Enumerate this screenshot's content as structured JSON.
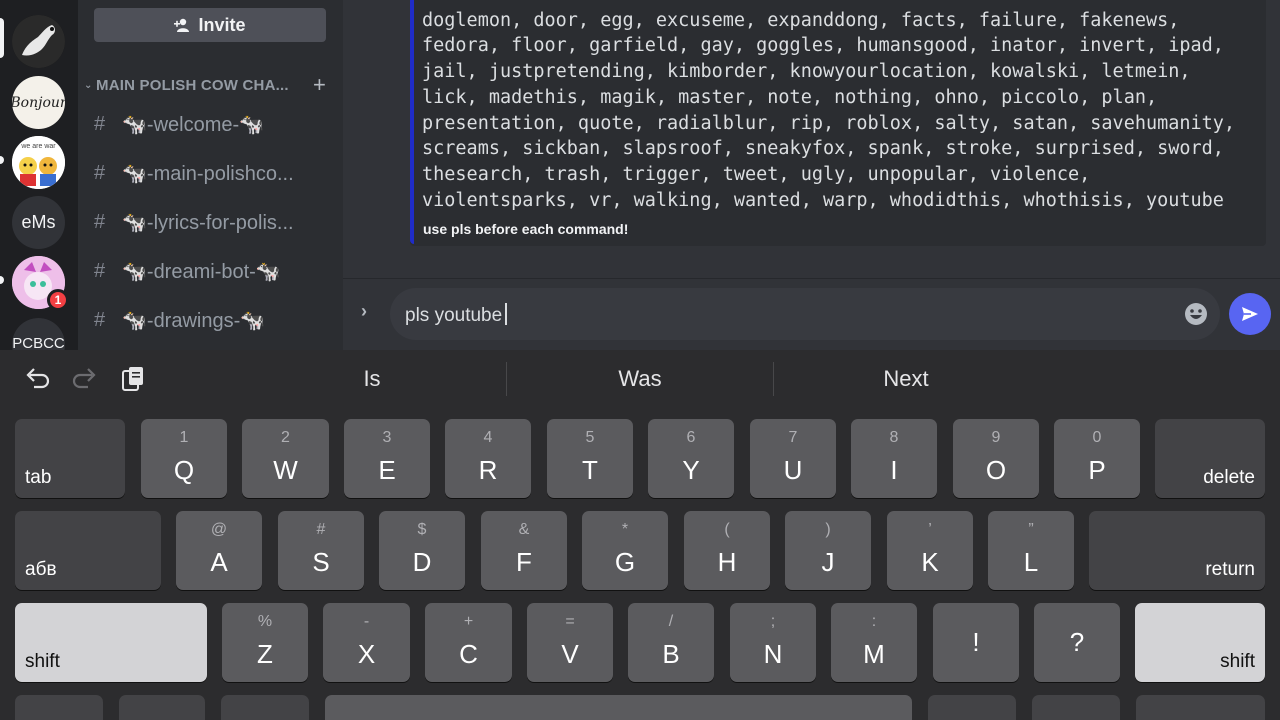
{
  "sidebar": {
    "invite_label": "Invite",
    "category": "MAIN POLISH COW CHA...",
    "channels": [
      {
        "label": "🐄-welcome-🐄"
      },
      {
        "label": "🐄-main-polishco..."
      },
      {
        "label": "🐄-lyrics-for-polis..."
      },
      {
        "label": "🐄-dreami-bot-🐄"
      },
      {
        "label": "🐄-drawings-🐄"
      }
    ]
  },
  "servers": {
    "bonjour_text": "Bonjour",
    "were_war_text": "we are war",
    "ems_label": "eMs",
    "badge_count": "1",
    "pcbcc_label": "PCBCC"
  },
  "embed": {
    "command_lines": [
      "                                           ",
      "doglemon, door, egg, excuseme, expanddong, facts, failure, fakenews,",
      "fedora, floor, garfield, gay, goggles, humansgood, inator, invert, ipad,",
      "jail, justpretending, kimborder, knowyourlocation, kowalski, letmein,",
      "lick, madethis, magik, master, note, nothing, ohno, piccolo, plan,",
      "presentation, quote, radialblur, rip, roblox, salty, satan, savehumanity,",
      "screams, sickban, slapsroof, sneakyfox, spank, stroke, surprised, sword,",
      "thesearch, trash, trigger, tweet, ugly, unpopular, violence,",
      "violentsparks, vr, walking, wanted, warp, whodidthis, whothisis, youtube"
    ],
    "footer": "use pls before each command!",
    "accent_color": "#1f2cc7"
  },
  "composer": {
    "value": "pls youtube"
  },
  "keyboard": {
    "suggestions": [
      "Is",
      "Was",
      "Next"
    ],
    "row1": [
      {
        "alt": "1",
        "main": "Q"
      },
      {
        "alt": "2",
        "main": "W"
      },
      {
        "alt": "3",
        "main": "E"
      },
      {
        "alt": "4",
        "main": "R"
      },
      {
        "alt": "5",
        "main": "T"
      },
      {
        "alt": "6",
        "main": "Y"
      },
      {
        "alt": "7",
        "main": "U"
      },
      {
        "alt": "8",
        "main": "I"
      },
      {
        "alt": "9",
        "main": "O"
      },
      {
        "alt": "0",
        "main": "P"
      }
    ],
    "row2": [
      {
        "alt": "@",
        "main": "A"
      },
      {
        "alt": "#",
        "main": "S"
      },
      {
        "alt": "$",
        "main": "D"
      },
      {
        "alt": "&",
        "main": "F"
      },
      {
        "alt": "*",
        "main": "G"
      },
      {
        "alt": "(",
        "main": "H"
      },
      {
        "alt": ")",
        "main": "J"
      },
      {
        "alt": "’",
        "main": "K"
      },
      {
        "alt": "”",
        "main": "L"
      }
    ],
    "row3": [
      {
        "alt": "%",
        "main": "Z"
      },
      {
        "alt": "-",
        "main": "X"
      },
      {
        "alt": "+",
        "main": "C"
      },
      {
        "alt": "=",
        "main": "V"
      },
      {
        "alt": "/",
        "main": "B"
      },
      {
        "alt": ";",
        "main": "N"
      },
      {
        "alt": ":",
        "main": "M"
      },
      {
        "alt": "",
        "main": "!"
      },
      {
        "alt": "",
        "main": "?"
      }
    ],
    "tab_label": "tab",
    "delete_label": "delete",
    "lang_label": "абв",
    "return_label": "return",
    "shift_label": "shift"
  }
}
